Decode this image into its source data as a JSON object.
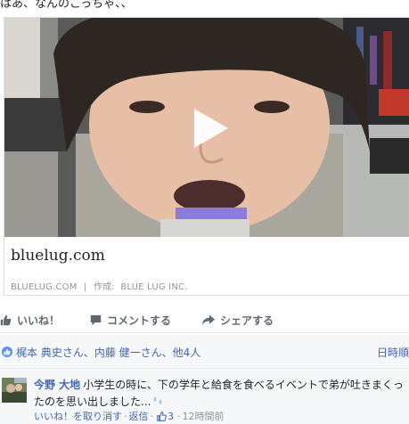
{
  "post": {
    "top_text": "はあ、なんのこっちゃ、、"
  },
  "link_card": {
    "title": "bluelug.com",
    "domain": "BLUELUG.COM",
    "separator": "|",
    "author_prefix": "作成:",
    "author": "BLUE LUG INC."
  },
  "actions": {
    "like": "いいね！",
    "comment": "コメントする",
    "share": "シェアする"
  },
  "reactions": {
    "summary": "梶本 典史さん、内藤 健一さん、他4人",
    "sort_label": "日時順"
  },
  "comment": {
    "author": "今野 大地",
    "text": "小学生の時に、下の学年と給食を食べるイベントで弟が吐きまくったのを思い出しました...",
    "unlike": "いいね！を取り消す",
    "reply": "返信",
    "like_count": "3",
    "time": "12時間前"
  },
  "colors": {
    "link_blue": "#4267b2",
    "meta_gray": "#90949c",
    "action_gray": "#616770",
    "like_icon_bg": "#5890ff"
  },
  "icons": {
    "play": "play-icon",
    "like": "thumbs-up-icon",
    "comment": "comment-bubble-icon",
    "share": "share-arrow-icon"
  }
}
